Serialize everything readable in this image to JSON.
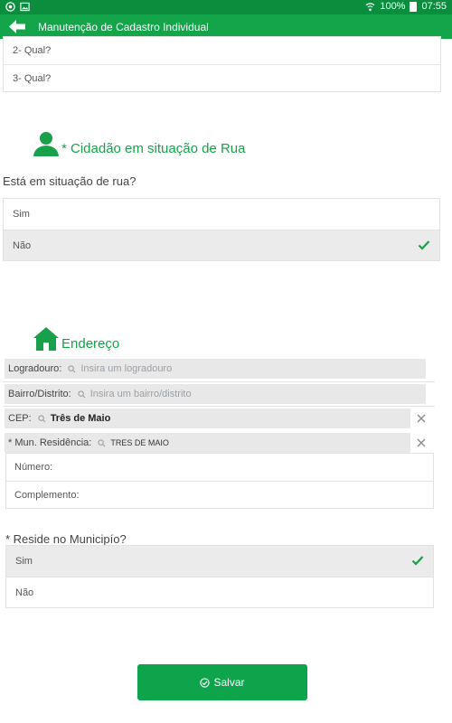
{
  "status_bar": {
    "battery": "100%",
    "time": "07:55"
  },
  "app_bar": {
    "title": "Manutenção de Cadastro Individual"
  },
  "top_list": {
    "items": [
      "2- Qual?",
      "3- Qual?"
    ]
  },
  "street_section": {
    "heading": "* Cidadão em situação de Rua",
    "question": "Está em situação de rua?",
    "options": [
      {
        "label": "Sim",
        "selected": false
      },
      {
        "label": "Não",
        "selected": true
      }
    ]
  },
  "address_section": {
    "heading": "Endereço",
    "logradouro": {
      "label": "Logradouro:",
      "placeholder": "Insira um logradouro"
    },
    "bairro": {
      "label": "Bairro/Distrito:",
      "placeholder": "Insira um bairro/distrito"
    },
    "cep": {
      "label": "CEP:",
      "value": "Três de Maio"
    },
    "municipio": {
      "label": "* Mun. Residência:",
      "value": "TRES DE MAIO"
    },
    "numero": {
      "label": "Número:"
    },
    "complemento": {
      "label": "Complemento:"
    }
  },
  "resides_section": {
    "question": "* Reside no Municipío?",
    "options": [
      {
        "label": "Sim",
        "selected": true
      },
      {
        "label": "Não",
        "selected": false
      }
    ]
  },
  "save_button": {
    "label": "Salvar"
  },
  "colors": {
    "status_bar": "#0b8d3e",
    "app_bar": "#14a44a",
    "accent": "#18a14a",
    "button": "#0ea44b"
  }
}
